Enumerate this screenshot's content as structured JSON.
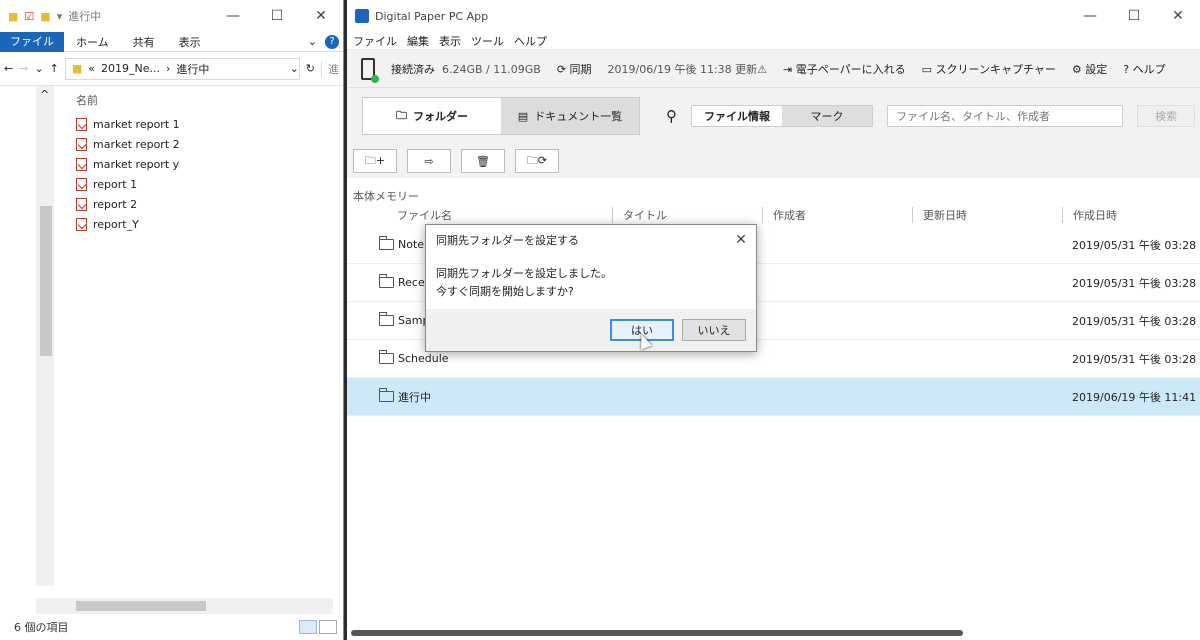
{
  "explorer": {
    "title": "進行中",
    "ribbon_tabs": [
      "ファイル",
      "ホーム",
      "共有",
      "表示"
    ],
    "address": {
      "prefix": "«",
      "crumb1": "2019_Ne...",
      "crumb2": "進行中",
      "search_placeholder": "進"
    },
    "column_name": "名前",
    "files": [
      {
        "name": "market report 1"
      },
      {
        "name": "market report 2"
      },
      {
        "name": "market report y"
      },
      {
        "name": "report 1"
      },
      {
        "name": "report 2"
      },
      {
        "name": "report_Y"
      }
    ],
    "status": "6 個の項目"
  },
  "app": {
    "title": "Digital Paper PC App",
    "menu": [
      "ファイル",
      "編集",
      "表示",
      "ツール",
      "ヘルプ"
    ],
    "status": {
      "connection": "接続済み",
      "storage": "6.24GB / 11.09GB",
      "sync": "同期",
      "updated": "2019/06/19 午後 11:38 更新",
      "send": "電子ペーパーに入れる",
      "capture": "スクリーンキャプチャー",
      "settings": "設定",
      "help": "ヘルプ"
    },
    "modes": {
      "folder": "フォルダー",
      "documents": "ドキュメント一覧"
    },
    "search": {
      "tab_info": "ファイル情報",
      "tab_mark": "マーク",
      "placeholder": "ファイル名、タイトル、作成者",
      "button": "検索"
    },
    "memory_label": "本体メモリー",
    "columns": [
      "ファイル名",
      "タイトル",
      "作成者",
      "更新日時",
      "作成日時"
    ],
    "rows": [
      {
        "name": "Note",
        "created": "2019/05/31 午後 03:28"
      },
      {
        "name": "Recei",
        "created": "2019/05/31 午後 03:28"
      },
      {
        "name": "Samp",
        "created": "2019/05/31 午後 03:28"
      },
      {
        "name": "Schedule",
        "created": "2019/05/31 午後 03:28"
      },
      {
        "name": "進行中",
        "created": "2019/06/19 午後 11:41"
      }
    ]
  },
  "dialog": {
    "title": "同期先フォルダーを設定する",
    "line1": "同期先フォルダーを設定しました。",
    "line2": "今すぐ同期を開始しますか?",
    "yes": "はい",
    "no": "いいえ"
  }
}
